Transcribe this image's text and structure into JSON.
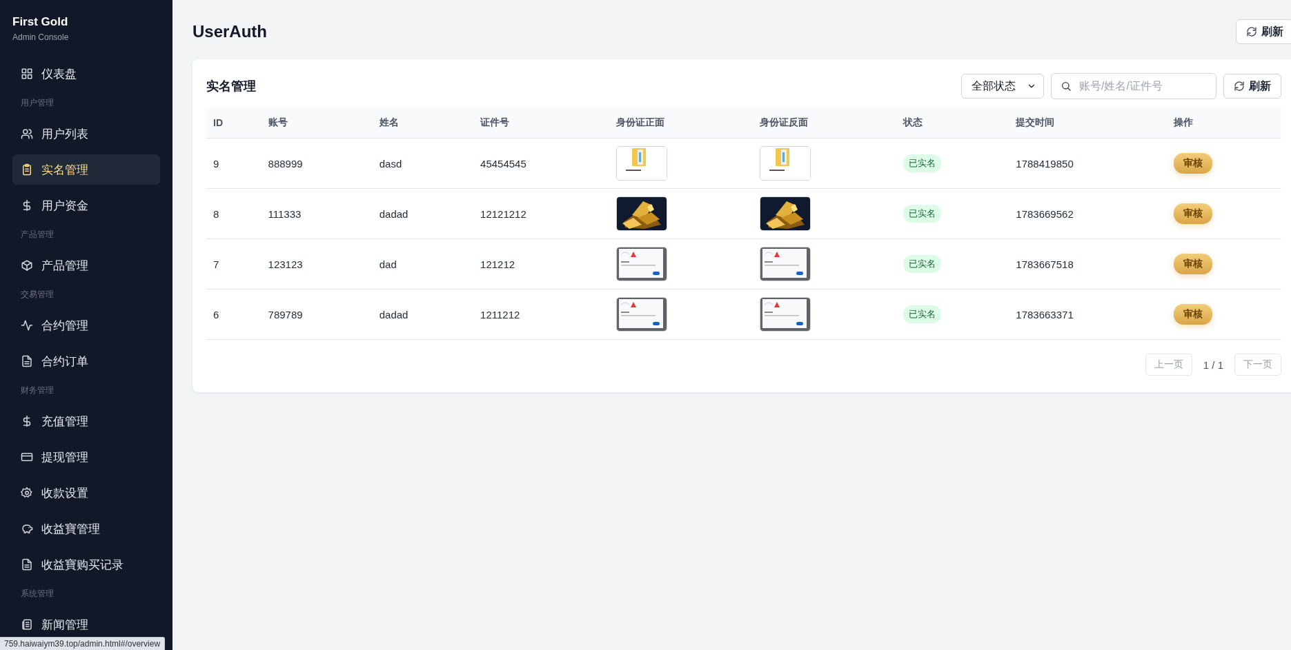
{
  "sidebar": {
    "brand": "First Gold",
    "subtitle": "Admin Console",
    "items": [
      {
        "kind": "item",
        "label": "仪表盘",
        "selected": false
      },
      {
        "kind": "section",
        "label": "用户管理"
      },
      {
        "kind": "item",
        "label": "用户列表",
        "selected": false
      },
      {
        "kind": "item",
        "label": "实名管理",
        "selected": true
      },
      {
        "kind": "item",
        "label": "用户资金",
        "selected": false
      },
      {
        "kind": "section",
        "label": "产品管理"
      },
      {
        "kind": "item",
        "label": "产品管理",
        "selected": false
      },
      {
        "kind": "section",
        "label": "交易管理"
      },
      {
        "kind": "item",
        "label": "合约管理",
        "selected": false
      },
      {
        "kind": "item",
        "label": "合约订单",
        "selected": false
      },
      {
        "kind": "section",
        "label": "财务管理"
      },
      {
        "kind": "item",
        "label": "充值管理",
        "selected": false
      },
      {
        "kind": "item",
        "label": "提现管理",
        "selected": false
      },
      {
        "kind": "item",
        "label": "收款设置",
        "selected": false
      },
      {
        "kind": "item",
        "label": "收益寶管理",
        "selected": false
      },
      {
        "kind": "item",
        "label": "收益寶购买记录",
        "selected": false
      },
      {
        "kind": "section",
        "label": "系统管理"
      },
      {
        "kind": "item",
        "label": "新闻管理",
        "selected": false
      }
    ]
  },
  "page": {
    "title": "UserAuth",
    "refresh_button": "刷新"
  },
  "card": {
    "title": "实名管理",
    "status_filter": "全部状态",
    "search": {
      "placeholder": "账号/姓名/证件号"
    },
    "refresh_button": "刷新",
    "table": {
      "columns": [
        "ID",
        "账号",
        "姓名",
        "证件号",
        "身份证正面",
        "身份证反面",
        "状态",
        "提交时间",
        "操作"
      ],
      "rows": [
        {
          "id": "9",
          "account": "888999",
          "name": "dasd",
          "id_number": "45454545",
          "status": "已实名",
          "submitted": "1788419850",
          "action": "审核"
        },
        {
          "id": "8",
          "account": "111333",
          "name": "dadad",
          "id_number": "12121212",
          "status": "已实名",
          "submitted": "1783669562",
          "action": "审核"
        },
        {
          "id": "7",
          "account": "123123",
          "name": "dad",
          "id_number": "121212",
          "status": "已实名",
          "submitted": "1783667518",
          "action": "审核"
        },
        {
          "id": "6",
          "account": "789789",
          "name": "dadad",
          "id_number": "1211212",
          "status": "已实名",
          "submitted": "1783663371",
          "action": "审核"
        }
      ]
    },
    "pagination": {
      "prev": {
        "label": "上一页",
        "disabled": true
      },
      "page": "1 / 1",
      "next": {
        "label": "下一页",
        "disabled": true
      }
    }
  },
  "status_bar": {
    "url": "759.haiwaiym39.top/admin.html#/overview"
  }
}
